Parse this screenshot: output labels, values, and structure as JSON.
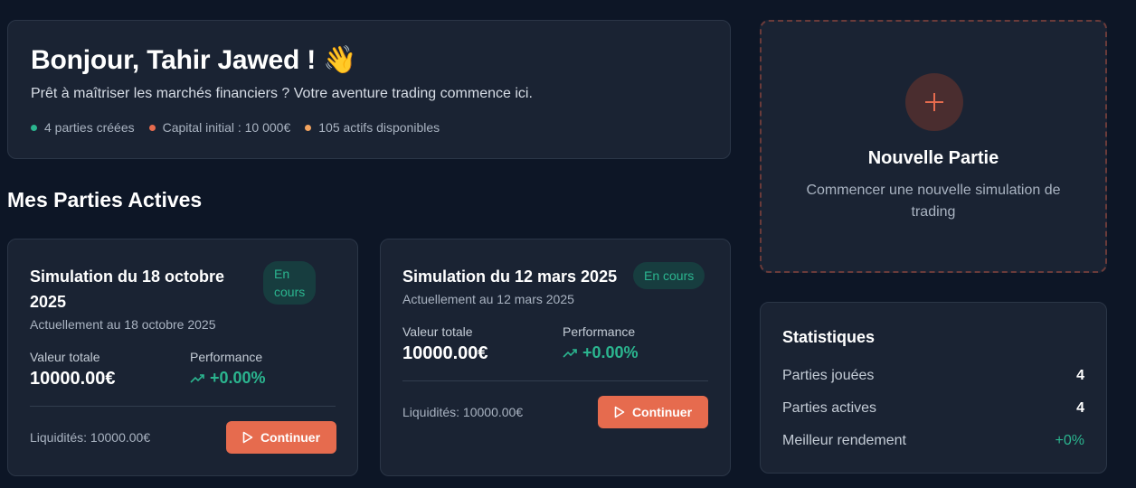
{
  "welcome": {
    "title": "Bonjour, Tahir Jawed !",
    "emoji": "👋",
    "subtitle": "Prêt à maîtriser les marchés financiers ? Votre aventure trading commence ici.",
    "meta": [
      {
        "text": "4 parties créées",
        "color": "#2bb58f"
      },
      {
        "text": "Capital initial : 10 000€",
        "color": "#e66b4e"
      },
      {
        "text": "105 actifs disponibles",
        "color": "#f2a35e"
      }
    ]
  },
  "section_title": "Mes Parties Actives",
  "games": [
    {
      "title_line1": "Simulation du 18 octobre",
      "title_line2": "2025",
      "badge_line1": "En",
      "badge_line2": "cours",
      "current_date": "Actuellement au 18 octobre 2025",
      "total_label": "Valeur totale",
      "total_value": "10000.00€",
      "perf_label": "Performance",
      "perf_value": "+0.00%",
      "cash": "Liquidités: 10000.00€",
      "button": "Continuer"
    },
    {
      "title": "Simulation du 12 mars 2025",
      "badge": "En cours",
      "current_date": "Actuellement au 12 mars 2025",
      "total_label": "Valeur totale",
      "total_value": "10000.00€",
      "perf_label": "Performance",
      "perf_value": "+0.00%",
      "cash": "Liquidités: 10000.00€",
      "button": "Continuer"
    }
  ],
  "new_game": {
    "title": "Nouvelle Partie",
    "description": "Commencer une nouvelle simulation de trading",
    "icon": "plus-icon"
  },
  "stats": {
    "title": "Statistiques",
    "rows": [
      {
        "label": "Parties jouées",
        "value": "4"
      },
      {
        "label": "Parties actives",
        "value": "4"
      },
      {
        "label": "Meilleur rendement",
        "value": "+0%"
      }
    ]
  },
  "colors": {
    "background": "#0d1626",
    "card": "#1a2333",
    "accent": "#e66b4e",
    "positive": "#2bb58f"
  }
}
